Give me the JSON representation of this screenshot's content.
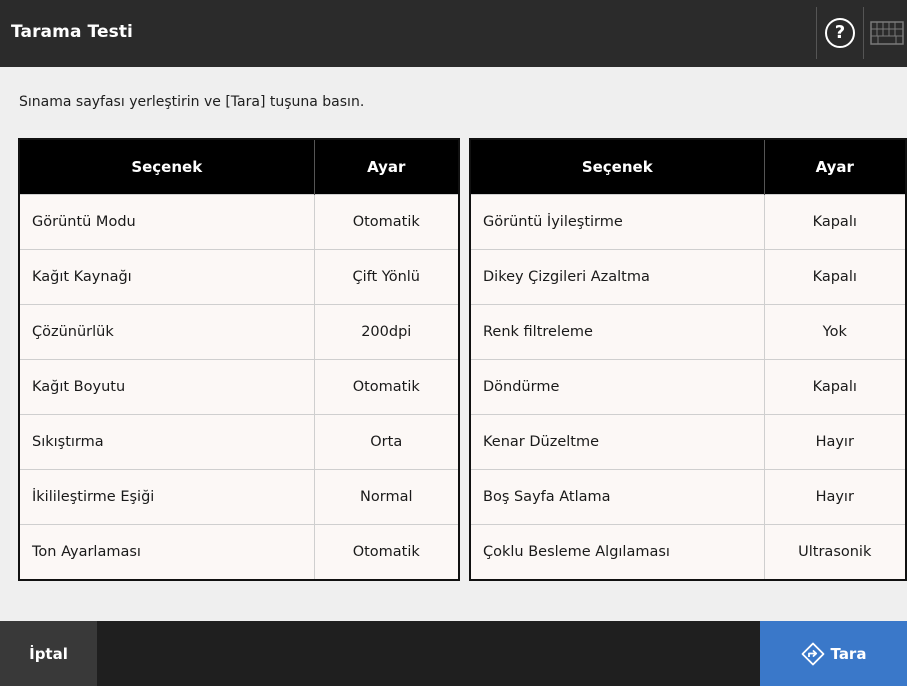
{
  "header": {
    "title": "Tarama Testi",
    "help_symbol": "?",
    "icons": [
      "help-icon",
      "keyboard-icon"
    ]
  },
  "instruction": "Sınama sayfası yerleştirin ve [Tara] tuşuna basın.",
  "table_headers": {
    "option": "Seçenek",
    "setting": "Ayar"
  },
  "left_table": [
    {
      "option": "Görüntü Modu",
      "setting": "Otomatik"
    },
    {
      "option": "Kağıt Kaynağı",
      "setting": "Çift Yönlü"
    },
    {
      "option": "Çözünürlük",
      "setting": "200dpi"
    },
    {
      "option": "Kağıt Boyutu",
      "setting": "Otomatik"
    },
    {
      "option": "Sıkıştırma",
      "setting": "Orta"
    },
    {
      "option": "İkilileştirme Eşiği",
      "setting": "Normal"
    },
    {
      "option": "Ton Ayarlaması",
      "setting": "Otomatik"
    }
  ],
  "right_table": [
    {
      "option": "Görüntü İyileştirme",
      "setting": "Kapalı"
    },
    {
      "option": "Dikey Çizgileri Azaltma",
      "setting": "Kapalı"
    },
    {
      "option": "Renk filtreleme",
      "setting": "Yok"
    },
    {
      "option": "Döndürme",
      "setting": "Kapalı"
    },
    {
      "option": "Kenar Düzeltme",
      "setting": "Hayır"
    },
    {
      "option": "Boş Sayfa Atlama",
      "setting": "Hayır"
    },
    {
      "option": "Çoklu Besleme Algılaması",
      "setting": "Ultrasonik"
    }
  ],
  "footer": {
    "cancel_label": "İptal",
    "scan_label": "Tara",
    "scan_icon": "diamond-arrow-icon"
  },
  "colors": {
    "header_bg": "#2b2b2b",
    "scan_button": "#3a78c9",
    "table_header": "#000000",
    "table_row_bg": "#fcf8f6"
  }
}
